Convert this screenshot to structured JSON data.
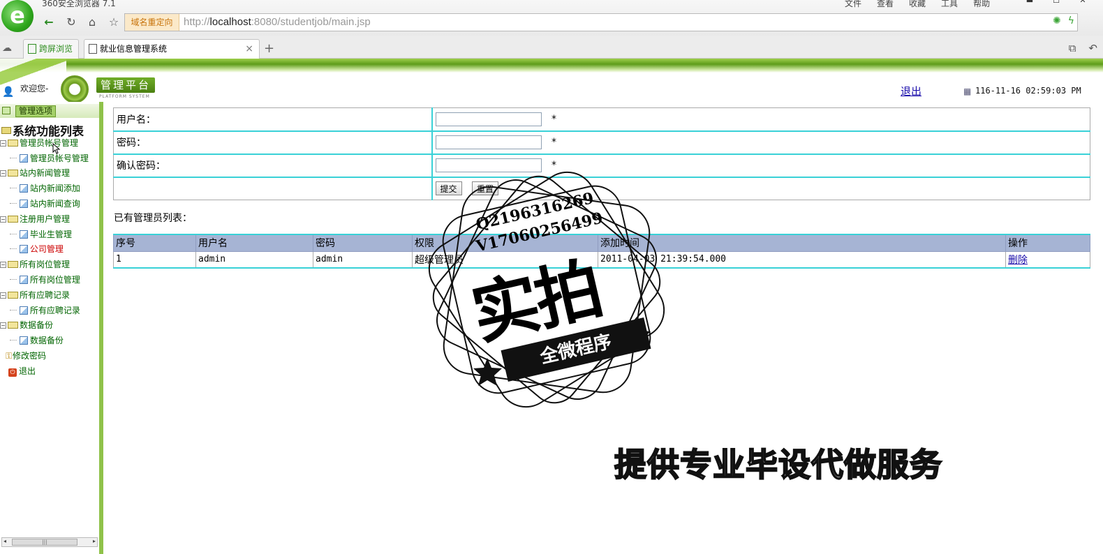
{
  "browser": {
    "app_title": "360安全浏览器 7.1",
    "menu": [
      "文件",
      "查看",
      "收藏",
      "工具",
      "帮助"
    ],
    "domain_tag": "域名重定向",
    "url_prefix": "http://",
    "url_host": "localhost",
    "url_rest": ":8080/studentjob/main.jsp",
    "tabs": [
      {
        "label": "跨屏浏览"
      },
      {
        "label": "就业信息管理系统"
      }
    ]
  },
  "header": {
    "welcome": "欢迎您-",
    "platform_title": "管理平台",
    "platform_sub": "PLATFORM SYSTEM",
    "logout": "退出",
    "clock": "116-11-16 02:59:03 PM"
  },
  "sidebar": {
    "head_label": "管理选项",
    "root": "系统功能列表",
    "groups": [
      {
        "label": "管理员帐号管理",
        "children": [
          "管理员帐号管理"
        ]
      },
      {
        "label": "站内新闻管理",
        "children": [
          "站内新闻添加",
          "站内新闻查询"
        ]
      },
      {
        "label": "注册用户管理",
        "children": [
          "毕业生管理",
          "公司管理"
        ]
      },
      {
        "label": "所有岗位管理",
        "children": [
          "所有岗位管理"
        ]
      },
      {
        "label": "所有应聘记录",
        "children": [
          "所有应聘记录"
        ]
      },
      {
        "label": "数据备份",
        "children": [
          "数据备份"
        ]
      }
    ],
    "change_password": "修改密码",
    "exit": "退出"
  },
  "form": {
    "username_label": "用户名：",
    "password_label": "密码：",
    "confirm_label": "确认密码：",
    "required_mark": "*",
    "submit": "提交",
    "reset": "重置"
  },
  "list": {
    "title": "已有管理员列表：",
    "columns": [
      "序号",
      "用户名",
      "密码",
      "权限",
      "添加时间",
      "操作"
    ],
    "rows": [
      {
        "index": "1",
        "username": "admin",
        "password": "admin",
        "role": "超级管理员",
        "added": "2011-04-03 21:39:54.000",
        "action": "删除"
      }
    ]
  },
  "watermark": {
    "qq": "Q2196316269",
    "wechat": "V17060256499",
    "big": "实拍",
    "banner": "全微程序",
    "slogan": "提供专业毕设代做服务"
  }
}
